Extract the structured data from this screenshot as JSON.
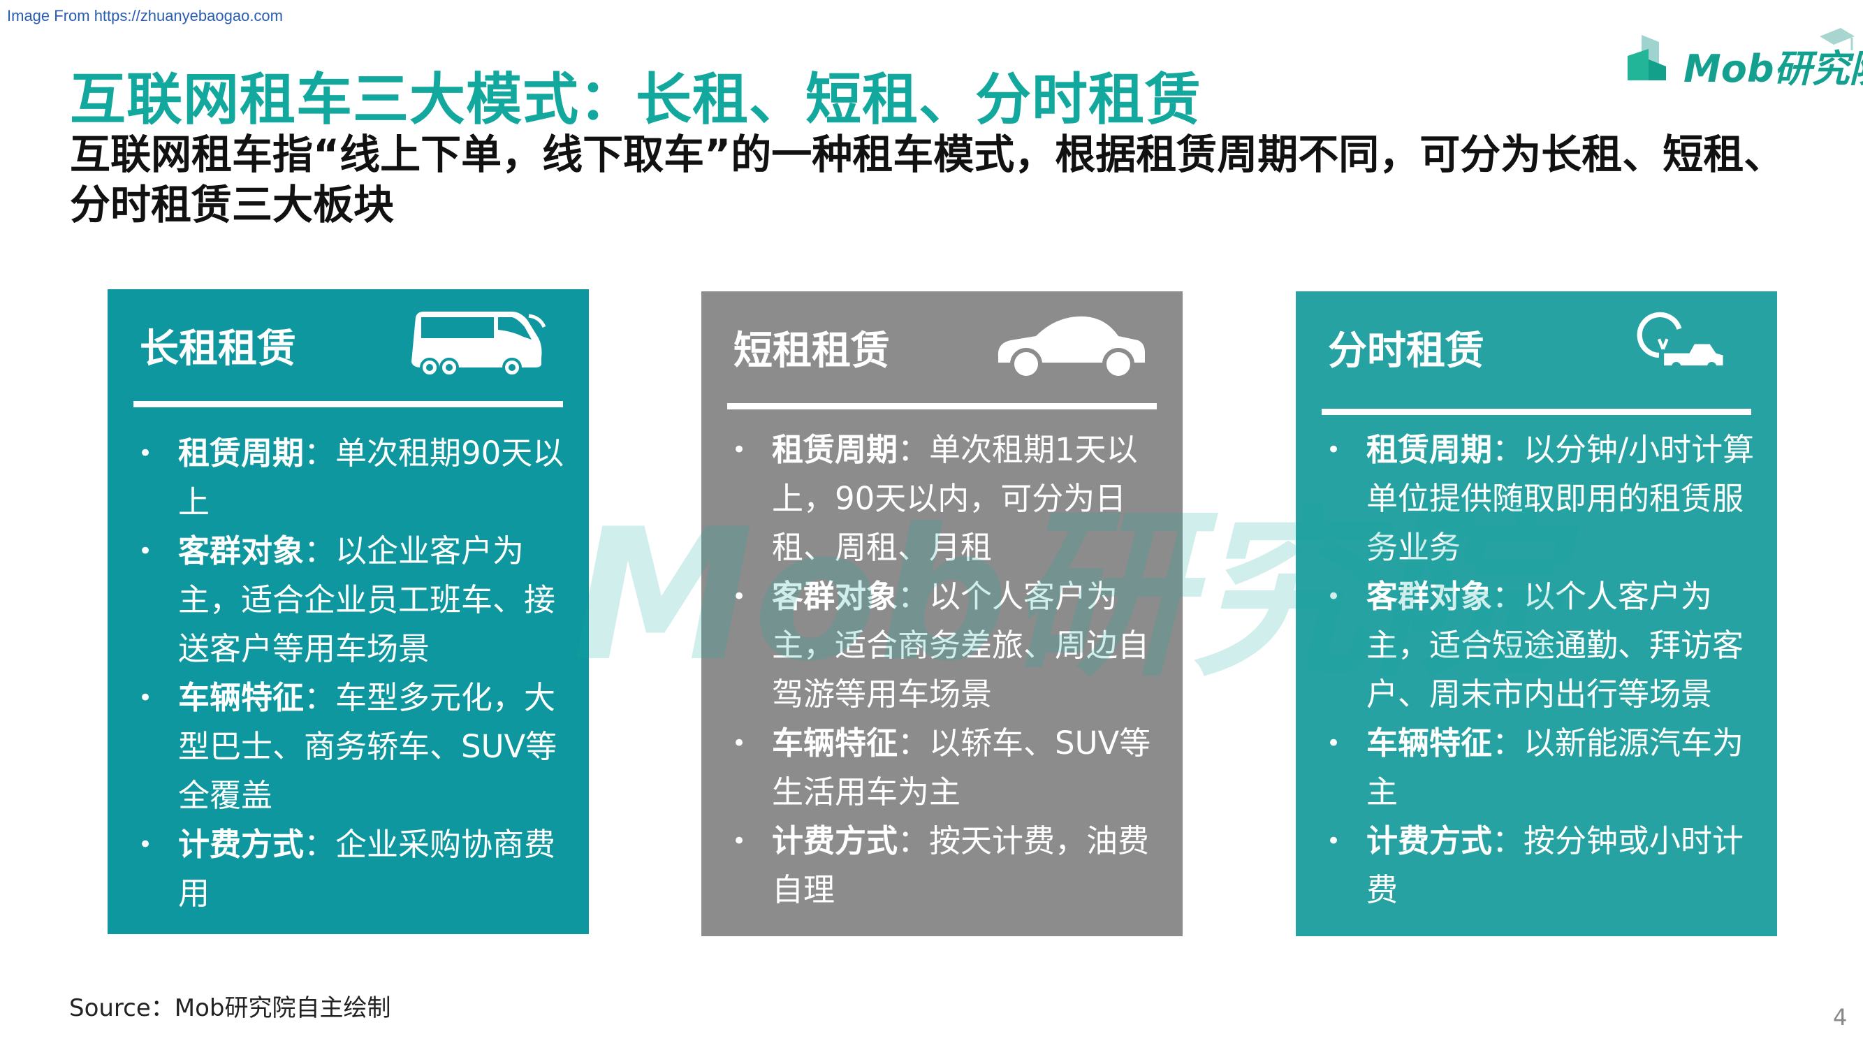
{
  "watermark_url": "Image From https://zhuanyebaogao.com",
  "title": "互联网租车三大模式：长租、短租、分时租赁",
  "subtitle": "互联网租车指“线上下单，线下取车”的一种租车模式，根据租赁周期不同，可分为长租、短租、分时租赁三大板块",
  "logo": {
    "text": "Mob研究院"
  },
  "background_watermark": "Mob研究院",
  "colors": {
    "title": "#13a89e",
    "panel1": "#0e979e",
    "panel2": "#8c8c8c",
    "panel3": "#26a2a2"
  },
  "panels": [
    {
      "title": "长租租赁",
      "icon": "bus-icon",
      "items": [
        {
          "label": "租赁周期",
          "text": "：单次租期90天以上"
        },
        {
          "label": "客群对象",
          "text": "：以企业客户为主，适合企业员工班车、接送客户等用车场景"
        },
        {
          "label": "车辆特征",
          "text": "：车型多元化，大型巴士、商务轿车、SUV等全覆盖"
        },
        {
          "label": "计费方式",
          "text": "：企业采购协商费用"
        }
      ]
    },
    {
      "title": "短租租赁",
      "icon": "car-icon",
      "items": [
        {
          "label": "租赁周期",
          "text": "：单次租期1天以上，90天以内，可分为日租、周租、月租"
        },
        {
          "label": "客群对象",
          "text": "：以个人客户为主，适合商务差旅、周边自驾游等用车场景"
        },
        {
          "label": "车辆特征",
          "text": "：以轿车、SUV等生活用车为主"
        },
        {
          "label": "计费方式",
          "text": "：按天计费，油费自理"
        }
      ]
    },
    {
      "title": "分时租赁",
      "icon": "timer-car-icon",
      "items": [
        {
          "label": "租赁周期",
          "text": "：以分钟/小时计算单位提供随取即用的租赁服务业务"
        },
        {
          "label": "客群对象",
          "text": "：以个人客户为主，适合短途通勤、拜访客户、周末市内出行等场景"
        },
        {
          "label": "车辆特征",
          "text": "：以新能源汽车为主"
        },
        {
          "label": "计费方式",
          "text": "：按分钟或小时计费"
        }
      ]
    }
  ],
  "source": "Source：Mob研究院自主绘制",
  "page_number": "4"
}
